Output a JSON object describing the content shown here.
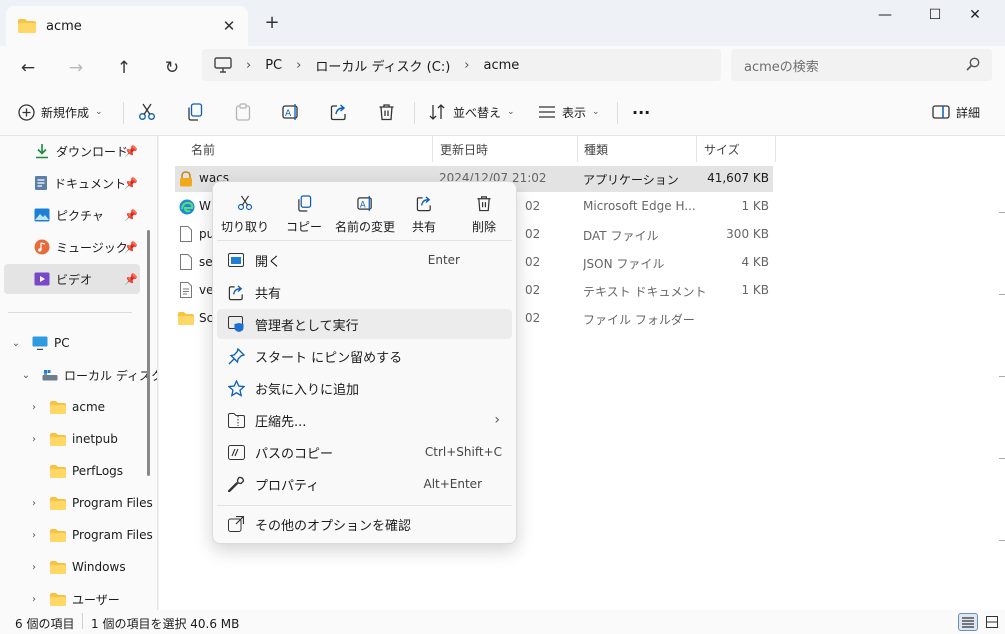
{
  "window": {
    "tab_title": "acme",
    "new_tab": "+",
    "close_tab": "✕",
    "minimize": "—",
    "maximize": "☐",
    "close": "✕"
  },
  "address": {
    "breadcrumb": [
      "PC",
      "ローカル ディスク (C:)",
      "acme"
    ],
    "search_placeholder": "acmeの検索"
  },
  "toolbar": {
    "new_label": "新規作成",
    "sort_label": "並べ替え",
    "view_label": "表示",
    "more": "···",
    "details_label": "詳細"
  },
  "sidebar": {
    "quick": [
      {
        "label": "ダウンロード"
      },
      {
        "label": "ドキュメント"
      },
      {
        "label": "ピクチャ"
      },
      {
        "label": "ミュージック"
      },
      {
        "label": "ビデオ"
      }
    ],
    "pc": "PC",
    "local_disk": "ローカル ディスク",
    "folders": [
      "acme",
      "inetpub",
      "PerfLogs",
      "Program Files",
      "Program Files",
      "Windows",
      "ユーザー"
    ]
  },
  "columns": {
    "name": "名前",
    "date": "更新日時",
    "type": "種類",
    "size": "サイズ"
  },
  "files": [
    {
      "name": "wacs",
      "date": "2024/12/07 21:02",
      "type": "アプリケーション",
      "size": "41,607 KB"
    },
    {
      "name": "W",
      "date": "02",
      "type": "Microsoft Edge H...",
      "size": "1 KB"
    },
    {
      "name": "pu",
      "date": "02",
      "type": "DAT ファイル",
      "size": "300 KB"
    },
    {
      "name": "se",
      "date": "02",
      "type": "JSON ファイル",
      "size": "4 KB"
    },
    {
      "name": "ve",
      "date": "02",
      "type": "テキスト ドキュメント",
      "size": "1 KB"
    },
    {
      "name": "Sc",
      "date": "02",
      "type": "ファイル フォルダー",
      "size": ""
    }
  ],
  "context_menu": {
    "quick_actions": [
      "切り取り",
      "コピー",
      "名前の変更",
      "共有",
      "削除"
    ],
    "items": [
      {
        "label": "開く",
        "shortcut": "Enter"
      },
      {
        "label": "共有",
        "shortcut": ""
      },
      {
        "label": "管理者として実行",
        "shortcut": ""
      },
      {
        "label": "スタート にピン留めする",
        "shortcut": ""
      },
      {
        "label": "お気に入りに追加",
        "shortcut": ""
      },
      {
        "label": "圧縮先...",
        "shortcut": ""
      },
      {
        "label": "パスのコピー",
        "shortcut": "Ctrl+Shift+C"
      },
      {
        "label": "プロパティ",
        "shortcut": "Alt+Enter"
      },
      {
        "label": "その他のオプションを確認",
        "shortcut": ""
      }
    ],
    "submenu_arrow": "›"
  },
  "status": {
    "count": "6 個の項目",
    "selected": "1 個の項目を選択  40.6 MB"
  }
}
